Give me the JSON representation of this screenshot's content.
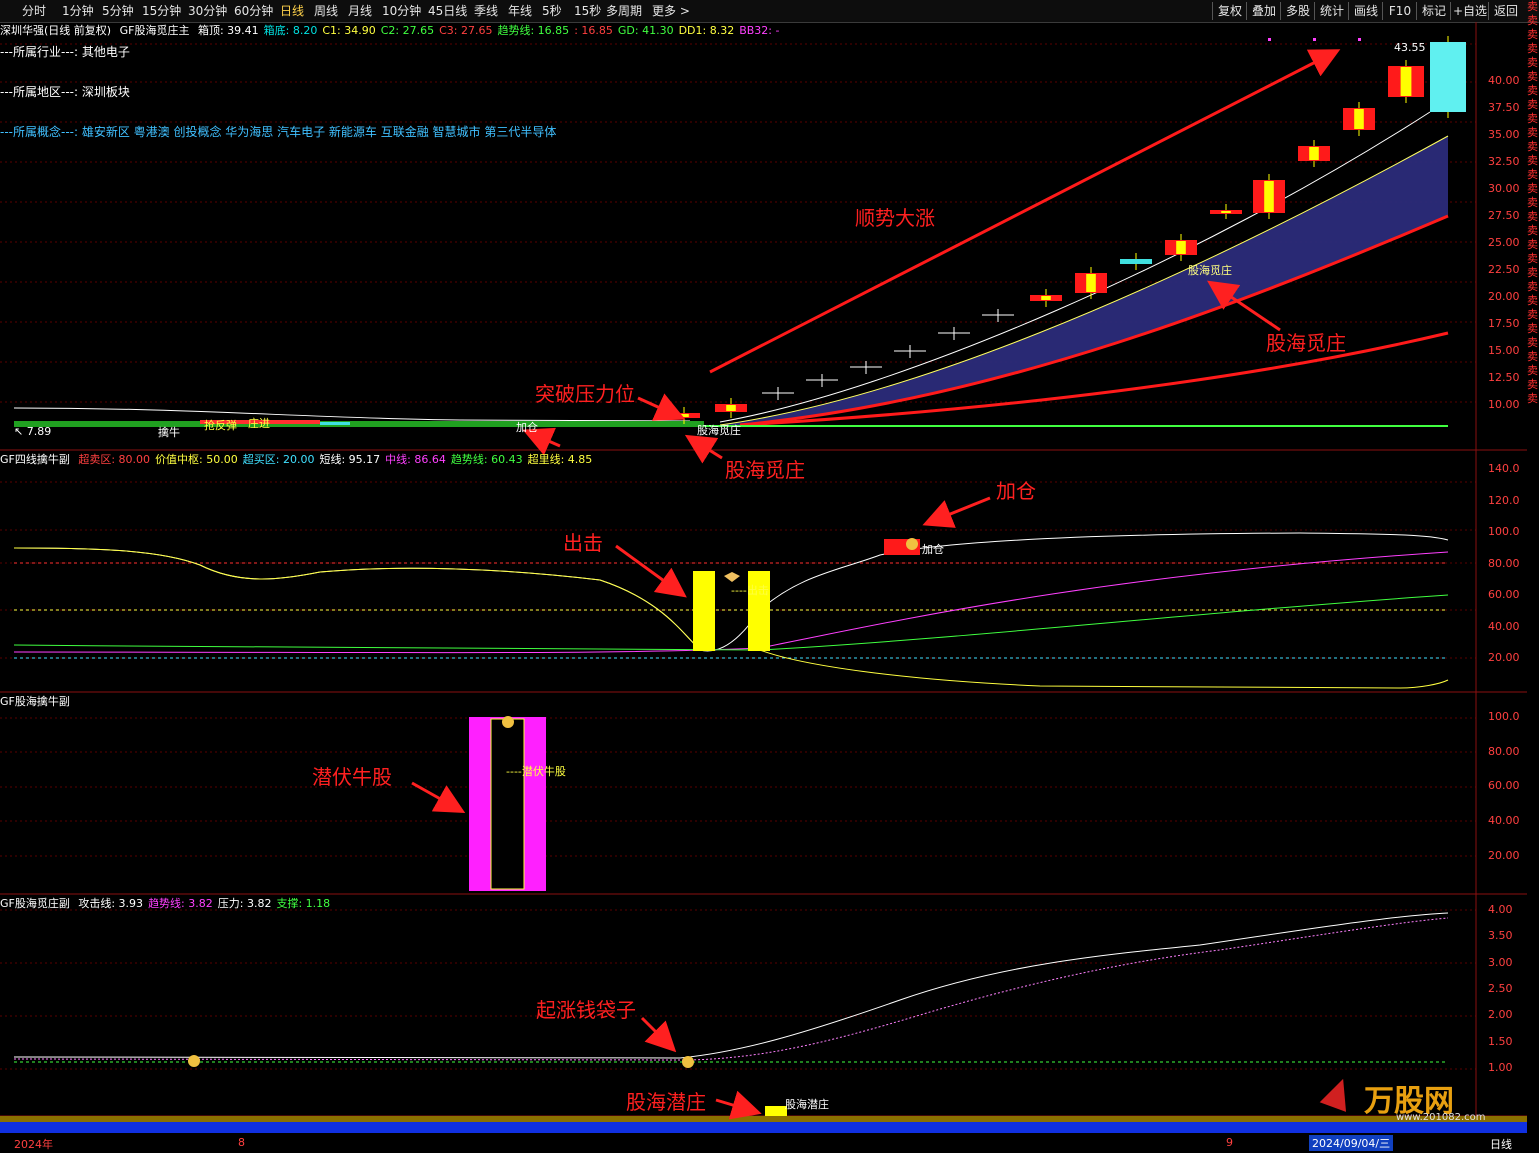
{
  "toolbar": {
    "periods": [
      "分时",
      "1分钟",
      "5分钟",
      "15分钟",
      "30分钟",
      "60分钟",
      "日线",
      "周线",
      "月线",
      "10分钟",
      "45日线",
      "季线",
      "年线",
      "5秒",
      "15秒",
      "多周期",
      "更多 >"
    ],
    "active_index": 6,
    "tools": [
      "复权",
      "叠加",
      "多股",
      "统计",
      "画线",
      "F10",
      "标记",
      "+自选",
      "返回"
    ]
  },
  "main_panel": {
    "stock": "深圳华强(日线 前复权)",
    "indicator_name": "GF股海觅庄主",
    "values": [
      {
        "label": "箱顶: 39.41",
        "color": "#ffffff"
      },
      {
        "label": "箱底: 8.20",
        "color": "#00e0e0"
      },
      {
        "label": "C1: 34.90",
        "color": "#ffff40"
      },
      {
        "label": "C2: 27.65",
        "color": "#40ff40"
      },
      {
        "label": "C3: 27.65",
        "color": "#ff4040"
      },
      {
        "label": "趋势线: 16.85",
        "color": "#40ff40"
      },
      {
        "label": ": 16.85",
        "color": "#ff4040"
      },
      {
        "label": "GD: 41.30",
        "color": "#40ff40"
      },
      {
        "label": "DD1: 8.32",
        "color": "#ffff40"
      },
      {
        "label": "BB32: -",
        "color": "#ff40ff"
      }
    ],
    "info": [
      {
        "text": "---所属行业---:  其他电子",
        "color": "#ffffff"
      },
      {
        "text": "---所属地区---:  深圳板块",
        "color": "#ffffff"
      },
      {
        "text": "---所属概念---:  雄安新区 粤港澳 创投概念 华为海思 汽车电子 新能源车 互联金融 智慧城市 第三代半导体",
        "color": "#40c0ff"
      }
    ],
    "price_top": "43.55",
    "price_low": "7.89",
    "axis": [
      "40.00",
      "37.50",
      "35.00",
      "32.50",
      "30.00",
      "27.50",
      "25.00",
      "22.50",
      "20.00",
      "17.50",
      "15.00",
      "12.50",
      "10.00"
    ],
    "chart_labels": [
      {
        "text": "股海觅庄",
        "color": "#ffff80"
      },
      {
        "text": "股海觅庄",
        "color": "#ffffff"
      },
      {
        "text": "擒牛",
        "color": "#ffffff"
      },
      {
        "text": "抢反弹",
        "color": "#ffff40"
      },
      {
        "text": "庄进",
        "color": "#ffff40"
      },
      {
        "text": "加仓",
        "color": "#ffffff"
      }
    ]
  },
  "panel2": {
    "indicator_name": "GF四线擒牛副",
    "values": [
      {
        "label": "超卖区: 80.00",
        "color": "#ff4040"
      },
      {
        "label": "价值中枢: 50.00",
        "color": "#ffff40"
      },
      {
        "label": "超买区: 20.00",
        "color": "#40e0ff"
      },
      {
        "label": "短线: 95.17",
        "color": "#ffffff"
      },
      {
        "label": "中线: 86.64",
        "color": "#ff40ff"
      },
      {
        "label": "趋势线: 60.43",
        "color": "#40ff40"
      },
      {
        "label": "超里线: 4.85",
        "color": "#ffff40"
      }
    ],
    "axis": [
      "140.0",
      "120.0",
      "100.0",
      "80.00",
      "60.00",
      "40.00",
      "20.00"
    ],
    "chart_labels": [
      "加仓",
      "----出击"
    ]
  },
  "panel3": {
    "indicator_name": "GF股海擒牛副",
    "axis": [
      "100.0",
      "80.00",
      "60.00",
      "40.00",
      "20.00"
    ],
    "chart_labels": [
      "----潜伏牛股"
    ]
  },
  "panel4": {
    "indicator_name": "GF股海觅庄副",
    "values": [
      {
        "label": "攻击线: 3.93",
        "color": "#ffffff"
      },
      {
        "label": "趋势线: 3.82",
        "color": "#ff40ff"
      },
      {
        "label": "压力: 3.82",
        "color": "#ffffff"
      },
      {
        "label": "支撑: 1.18",
        "color": "#40ff40"
      }
    ],
    "axis": [
      "4.00",
      "3.50",
      "3.00",
      "2.50",
      "2.00",
      "1.50",
      "1.00"
    ],
    "chart_labels": [
      "股海潜庄"
    ]
  },
  "annotations": [
    "顺势大涨",
    "突破压力位",
    "股海觅庄",
    "股海觅庄",
    "加仓",
    "出击",
    "潜伏牛股",
    "起涨钱袋子",
    "股海潜庄"
  ],
  "bottom": {
    "year": "2024年",
    "tick8": "8",
    "tick9": "9",
    "date": "2024/09/04/三",
    "mode": "日线"
  },
  "side_strip": "卖卖卖卖卖卖卖卖卖卖卖卖卖卖卖卖卖卖卖卖卖卖卖卖卖卖卖卖卖",
  "watermark": {
    "brand": "万股网",
    "url": "www.201082.com"
  },
  "colors": {
    "up": "#ff1a1a",
    "body": "#ffff00",
    "grid": "#5a0000",
    "band": "#2b2b7a"
  }
}
